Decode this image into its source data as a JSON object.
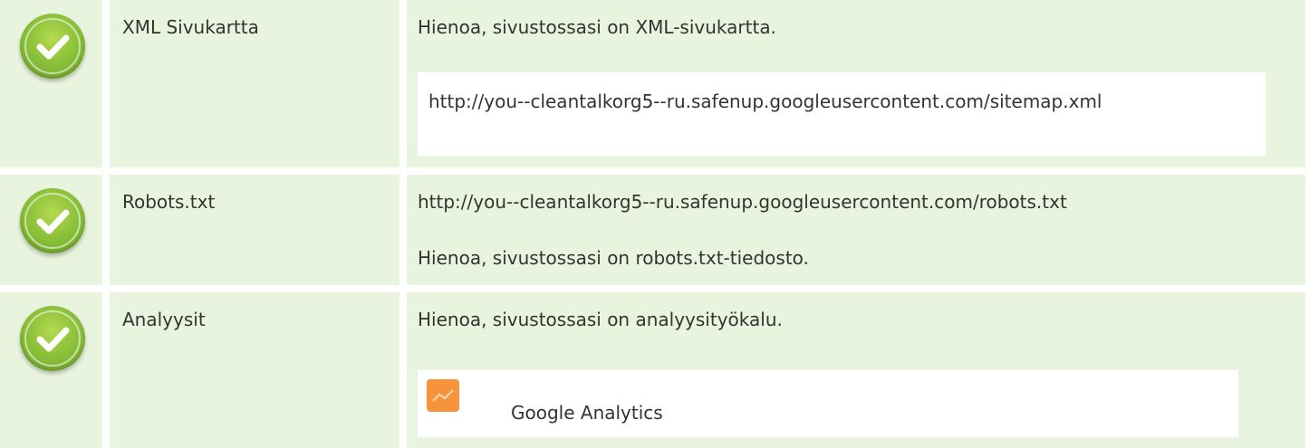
{
  "rows": [
    {
      "status": "pass",
      "title": "XML Sivukartta",
      "message": "Hienoa, sivustossasi on XML-sivukartta.",
      "url": "http://you--cleantalkorg5--ru.safenup.googleusercontent.com/sitemap.xml"
    },
    {
      "status": "pass",
      "title": "Robots.txt",
      "url": "http://you--cleantalkorg5--ru.safenup.googleusercontent.com/robots.txt",
      "message": "Hienoa, sivustossasi on robots.txt-tiedosto."
    },
    {
      "status": "pass",
      "title": "Analyysit",
      "message": "Hienoa, sivustossasi on analyysityökalu.",
      "tool": {
        "name": "Google Analytics",
        "icon": "google-analytics-icon",
        "color": "#f7933a"
      }
    }
  ],
  "colors": {
    "row_bg": "#e8f4dd",
    "check_green": "#8dc23a",
    "box_bg": "#ffffff",
    "text": "#333333"
  }
}
